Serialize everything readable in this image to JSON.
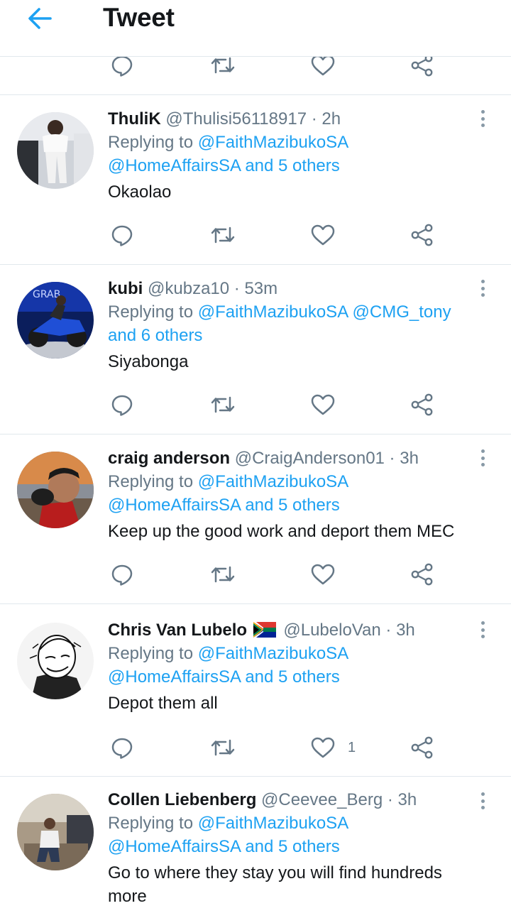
{
  "header": {
    "title": "Tweet",
    "back_icon": "arrow-left-icon",
    "accent": "#1da1f2"
  },
  "colors": {
    "link": "#1da1f2",
    "secondary": "#657786",
    "divider": "#e1e8ed"
  },
  "replying_prefix": "Replying to",
  "tweets": [
    {
      "name": "ThuliK",
      "handle": "@Thulisi56118917",
      "time": "2h",
      "reply_line1": "@FaithMazibukoSA",
      "reply_line2": "@HomeAffairsSA and 5 others",
      "text": "Okaolao",
      "like_count": ""
    },
    {
      "name": "kubi",
      "handle": "@kubza10",
      "time": "53m",
      "reply_line1": "@FaithMazibukoSA @CMG_tony",
      "reply_line2": "and 6 others",
      "text": "Siyabonga",
      "like_count": ""
    },
    {
      "name": "craig anderson",
      "handle": "@CraigAnderson01",
      "time": "3h",
      "reply_line1": "@FaithMazibukoSA",
      "reply_line2": "@HomeAffairsSA and 5 others",
      "text": "Keep up the good work and deport them MEC",
      "like_count": ""
    },
    {
      "name": "Chris Van Lubelo",
      "handle": "@LubeloVan",
      "time": "3h",
      "reply_line1": "@FaithMazibukoSA",
      "reply_line2": "@HomeAffairsSA and 5 others",
      "text": "Depot them all",
      "like_count": "1"
    },
    {
      "name": "Collen Liebenberg",
      "handle": "@Ceevee_Berg",
      "time": "3h",
      "reply_line1": "@FaithMazibukoSA",
      "reply_line2": "@HomeAffairsSA and 5 others",
      "text": "Go to where they stay you will find hundreds more",
      "like_count": ""
    }
  ]
}
